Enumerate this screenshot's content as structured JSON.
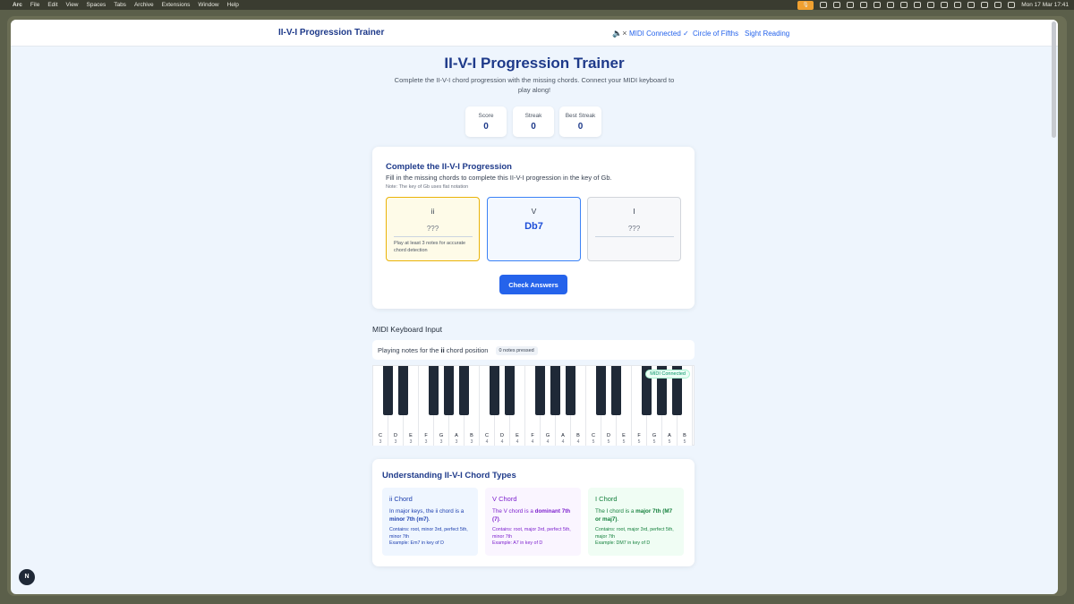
{
  "menubar": {
    "items": [
      "Arc",
      "File",
      "Edit",
      "View",
      "Spaces",
      "Tabs",
      "Archive",
      "Extensions",
      "Window",
      "Help"
    ],
    "datetime": "Mon 17 Mar  17:41"
  },
  "nav": {
    "brand": "II-V-I Progression Trainer",
    "speaker_icon": "speaker-muted-icon",
    "links": [
      "MIDI Connected ✓",
      "Circle of Fifths",
      "Sight Reading"
    ]
  },
  "header": {
    "title": "II-V-I Progression Trainer",
    "subtitle": "Complete the II-V-I chord progression with the missing chords. Connect your MIDI keyboard to play along!"
  },
  "stats": [
    {
      "label": "Score",
      "value": "0"
    },
    {
      "label": "Streak",
      "value": "0"
    },
    {
      "label": "Best Streak",
      "value": "0"
    }
  ],
  "progression": {
    "title": "Complete the II-V-I Progression",
    "description": "Fill in the missing chords to complete this II-V-I progression in the key of Gb.",
    "note": "Note: The key of Gb uses flat notation",
    "slots": [
      {
        "roman": "ii",
        "value": "???",
        "hint": "Play at least 3 notes for accurate chord detection"
      },
      {
        "roman": "V",
        "value": "Db7"
      },
      {
        "roman": "I",
        "value": "???"
      }
    ],
    "check_label": "Check Answers"
  },
  "midi": {
    "title": "MIDI Keyboard Input",
    "playing_prefix": "Playing notes for the",
    "playing_chord": "ii",
    "playing_suffix": "chord position",
    "pressed": "0 notes pressed",
    "badge": "MIDI Connected",
    "white_keys": [
      {
        "n": "C",
        "o": "3"
      },
      {
        "n": "D",
        "o": "3"
      },
      {
        "n": "E",
        "o": "3"
      },
      {
        "n": "F",
        "o": "3"
      },
      {
        "n": "G",
        "o": "3"
      },
      {
        "n": "A",
        "o": "3"
      },
      {
        "n": "B",
        "o": "3"
      },
      {
        "n": "C",
        "o": "4"
      },
      {
        "n": "D",
        "o": "4"
      },
      {
        "n": "E",
        "o": "4"
      },
      {
        "n": "F",
        "o": "4"
      },
      {
        "n": "G",
        "o": "4"
      },
      {
        "n": "A",
        "o": "4"
      },
      {
        "n": "B",
        "o": "4"
      },
      {
        "n": "C",
        "o": "5"
      },
      {
        "n": "D",
        "o": "5"
      },
      {
        "n": "E",
        "o": "5"
      },
      {
        "n": "F",
        "o": "5"
      },
      {
        "n": "G",
        "o": "5"
      },
      {
        "n": "A",
        "o": "5"
      },
      {
        "n": "B",
        "o": "5"
      }
    ]
  },
  "understanding": {
    "title": "Understanding II-V-I Chord Types",
    "cols": [
      {
        "title": "ii Chord",
        "desc_pre": "In major keys, the ii chord is a",
        "desc_bold": "minor 7th (m7)",
        "desc_post": ".",
        "contains": "Contains: root, minor 3rd, perfect 5th, minor 7th",
        "example": "Example: Em7 in key of D"
      },
      {
        "title": "V Chord",
        "desc_pre": "The V chord is a",
        "desc_bold": "dominant 7th (7)",
        "desc_post": ".",
        "contains": "Contains: root, major 3rd, perfect 5th, minor 7th",
        "example": "Example: A7 in key of D"
      },
      {
        "title": "I Chord",
        "desc_pre": "The I chord is a",
        "desc_bold": "major 7th (M7 or maj7)",
        "desc_post": ".",
        "contains": "Contains: root, major 3rd, perfect 5th, major 7th",
        "example": "Example: DM7 in key of D"
      }
    ]
  },
  "fab_label": "N"
}
